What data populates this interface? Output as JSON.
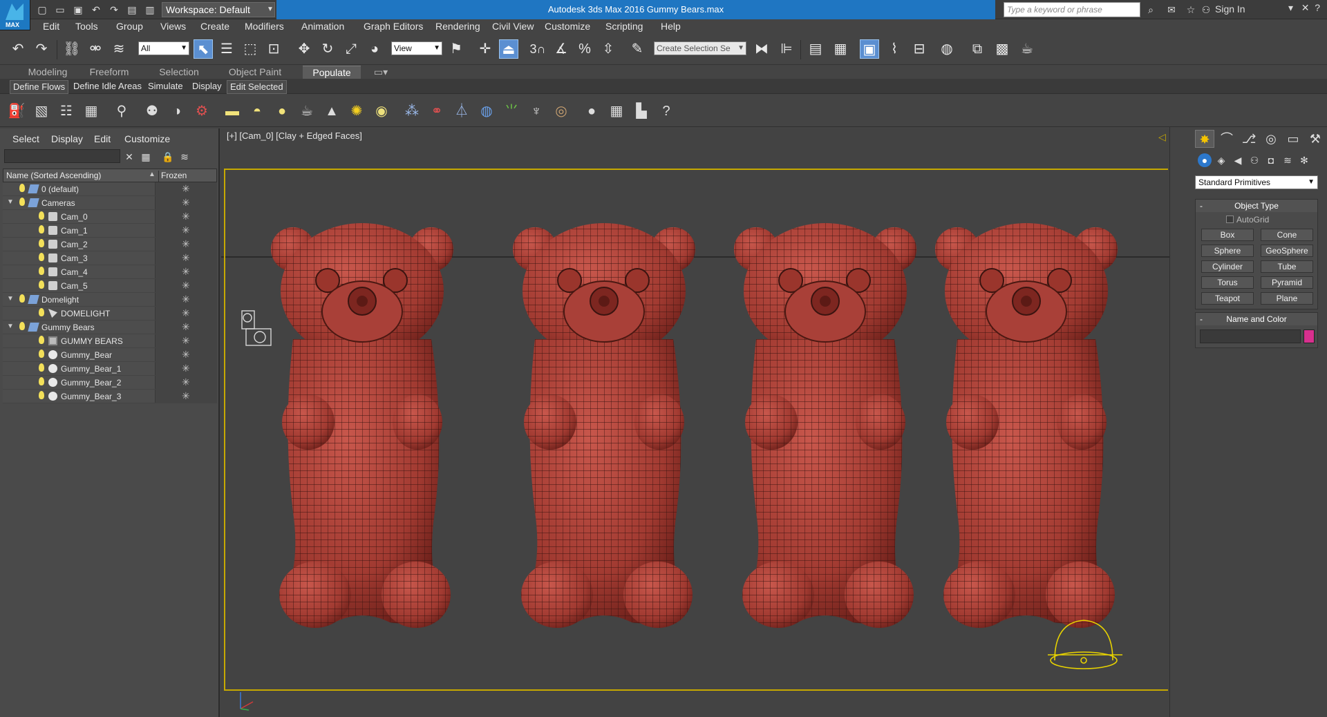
{
  "app": {
    "title": "Autodesk 3ds Max 2016    Gummy Bears.max",
    "logo_text": "MAX",
    "workspace": "Workspace: Default",
    "search_placeholder": "Type a keyword or phrase",
    "sign_in": "Sign In"
  },
  "menu": [
    "Edit",
    "Tools",
    "Group",
    "Views",
    "Create",
    "Modifiers",
    "Animation",
    "Graph Editors",
    "Rendering",
    "Civil View",
    "Customize",
    "Scripting",
    "Help"
  ],
  "toolbar": {
    "filter_value": "All",
    "refcoord_value": "View",
    "selection_set_value": "Create Selection Se",
    "snap_label": "3"
  },
  "ribbon": {
    "tabs": [
      "Modeling",
      "Freeform",
      "Selection",
      "Object Paint",
      "Populate"
    ],
    "active_tab": "Populate",
    "sub_items": [
      "Define Flows",
      "Define Idle Areas",
      "Simulate",
      "Display",
      "Edit Selected"
    ]
  },
  "explorer": {
    "menu": [
      "Select",
      "Display",
      "Edit",
      "Customize"
    ],
    "col_name": "Name (Sorted Ascending)",
    "col_frozen": "Frozen",
    "rows": [
      {
        "label": "0 (default)",
        "indent": 0,
        "type": "layer",
        "expand": ""
      },
      {
        "label": "Cameras",
        "indent": 0,
        "type": "layer",
        "expand": "▼"
      },
      {
        "label": "Cam_0",
        "indent": 1,
        "type": "camera",
        "expand": ""
      },
      {
        "label": "Cam_1",
        "indent": 1,
        "type": "camera",
        "expand": ""
      },
      {
        "label": "Cam_2",
        "indent": 1,
        "type": "camera",
        "expand": ""
      },
      {
        "label": "Cam_3",
        "indent": 1,
        "type": "camera",
        "expand": ""
      },
      {
        "label": "Cam_4",
        "indent": 1,
        "type": "camera",
        "expand": ""
      },
      {
        "label": "Cam_5",
        "indent": 1,
        "type": "camera",
        "expand": ""
      },
      {
        "label": "Domelight",
        "indent": 0,
        "type": "layer",
        "expand": "▼"
      },
      {
        "label": "DOMELIGHT",
        "indent": 1,
        "type": "light",
        "expand": ""
      },
      {
        "label": "Gummy Bears",
        "indent": 0,
        "type": "layer",
        "expand": "▼"
      },
      {
        "label": "GUMMY BEARS",
        "indent": 1,
        "type": "group",
        "expand": ""
      },
      {
        "label": "Gummy_Bear",
        "indent": 1,
        "type": "sphere",
        "expand": ""
      },
      {
        "label": "Gummy_Bear_1",
        "indent": 1,
        "type": "sphere",
        "expand": ""
      },
      {
        "label": "Gummy_Bear_2",
        "indent": 1,
        "type": "sphere",
        "expand": ""
      },
      {
        "label": "Gummy_Bear_3",
        "indent": 1,
        "type": "sphere",
        "expand": ""
      }
    ]
  },
  "viewport": {
    "label": "[+] [Cam_0] [Clay + Edged Faces]",
    "bear_color": "#b5433a",
    "bear_shadow": "#7d2620",
    "frame_color": "#c7a900"
  },
  "command_panel": {
    "category": "Standard Primitives",
    "object_type_title": "Object Type",
    "autogrid": "AutoGrid",
    "primitives": [
      "Box",
      "Cone",
      "Sphere",
      "GeoSphere",
      "Cylinder",
      "Tube",
      "Torus",
      "Pyramid",
      "Teapot",
      "Plane"
    ],
    "name_color_title": "Name and Color",
    "swatch_color": "#d8308e"
  }
}
